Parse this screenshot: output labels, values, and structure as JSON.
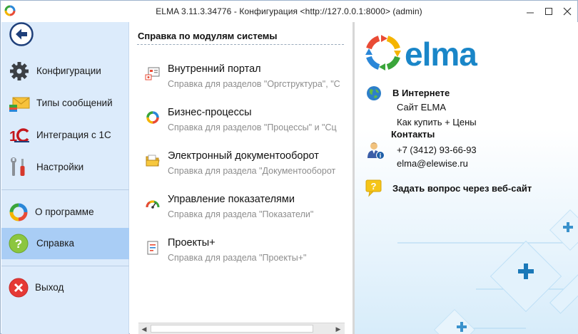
{
  "window": {
    "title": "ELMA 3.11.3.34776 - Конфигурация <http://127.0.0.1:8000> (admin)"
  },
  "sidebar": {
    "items": [
      {
        "label": "Конфигурации",
        "icon": "gear-icon"
      },
      {
        "label": "Типы сообщений",
        "icon": "envelope-icon"
      },
      {
        "label": "Интеграция с 1С",
        "icon": "1c-logo-icon"
      },
      {
        "label": "Настройки",
        "icon": "wrench-screwdriver-icon"
      },
      {
        "label": "О программе",
        "icon": "elma-ring-icon"
      },
      {
        "label": "Справка",
        "icon": "help-icon",
        "active": true
      },
      {
        "label": "Выход",
        "icon": "exit-icon"
      }
    ]
  },
  "modules": {
    "title": "Справка по модулям системы",
    "items": [
      {
        "title": "Внутренний портал",
        "desc": "Справка для разделов \"Оргструктура\", \"С",
        "icon": "portal-icon"
      },
      {
        "title": "Бизнес-процессы",
        "desc": "Справка для разделов \"Процессы\" и \"Сц",
        "icon": "bpm-ring-icon"
      },
      {
        "title": "Электронный документооборот",
        "desc": "Справка для раздела \"Документооборот",
        "icon": "folder-icon"
      },
      {
        "title": "Управление показателями",
        "desc": "Справка для раздела \"Показатели\"",
        "icon": "gauge-icon"
      },
      {
        "title": "Проекты+",
        "desc": "Справка для раздела \"Проекты+\"",
        "icon": "project-doc-icon"
      }
    ]
  },
  "info": {
    "internet_heading": "В Интернете",
    "site_link": "Сайт ELMA",
    "buy_link": "Как купить + Цены",
    "contacts_heading": "Контакты",
    "phone": "+7 (3412) 93-66-93",
    "email": "elma@elewise.ru",
    "ask_link": "Задать вопрос через веб-сайт",
    "logo_text": "elma"
  },
  "colors": {
    "sidebar_bg": "#dcebfb",
    "sidebar_active": "#a9cdf5",
    "elma_blue": "#1a86c8",
    "desc_gray": "#8d8d8d"
  }
}
